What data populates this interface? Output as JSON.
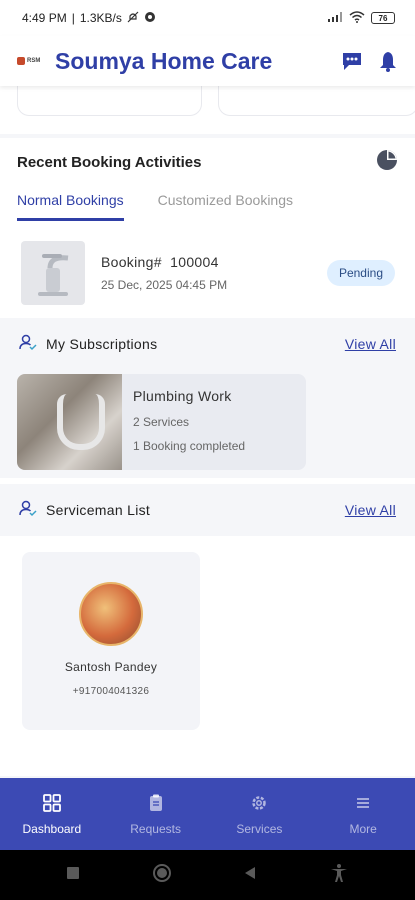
{
  "status_bar": {
    "time": "4:49 PM",
    "network_speed": "1.3KB/s",
    "battery_level": "76"
  },
  "header": {
    "logo_text": "RSM",
    "title": "Soumya Home Care",
    "chat_icon": "chat-icon",
    "bell_icon": "bell-icon"
  },
  "recent": {
    "title": "Recent Booking Activities",
    "chart_icon": "pie-chart-icon",
    "tabs": [
      {
        "label": "Normal Bookings",
        "active": true
      },
      {
        "label": "Customized Bookings",
        "active": false
      }
    ],
    "bookings": [
      {
        "label": "Booking#",
        "number": "100004",
        "date": "25 Dec, 2025 04:45 PM",
        "status": "Pending"
      }
    ]
  },
  "subscriptions": {
    "title": "My Subscriptions",
    "view_all": "View All",
    "items": [
      {
        "title": "Plumbing Work",
        "services": "2 Services",
        "bookings": "1 Booking completed"
      }
    ]
  },
  "servicemen": {
    "title": "Serviceman List",
    "view_all": "View All",
    "items": [
      {
        "name": "Santosh Pandey",
        "phone": "+917004041326"
      }
    ]
  },
  "bottom_nav": {
    "items": [
      {
        "label": "Dashboard",
        "icon": "grid-icon",
        "active": true
      },
      {
        "label": "Requests",
        "icon": "clipboard-icon",
        "active": false
      },
      {
        "label": "Services",
        "icon": "gear-icon",
        "active": false
      },
      {
        "label": "More",
        "icon": "menu-icon",
        "active": false
      }
    ]
  },
  "colors": {
    "primary": "#2f3fa6",
    "nav_bg": "#3c4ab4",
    "badge_bg": "#dfefff"
  }
}
